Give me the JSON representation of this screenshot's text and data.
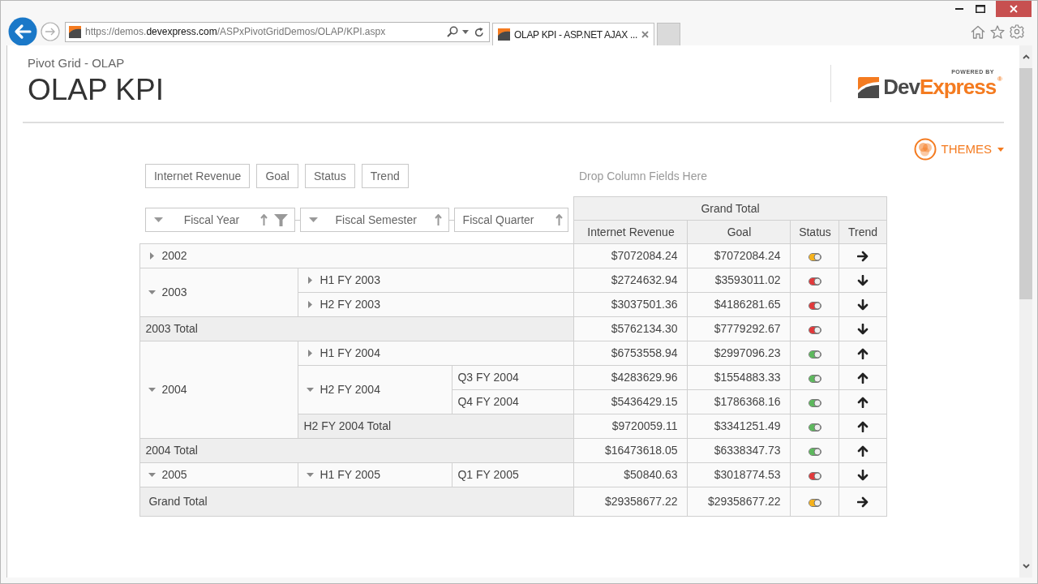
{
  "browser": {
    "address": {
      "url_before": "https://demos.",
      "url_domain": "devexpress.com",
      "url_after": "/ASPxPivotGridDemos/OLAP/KPI.aspx"
    },
    "tabs": [
      {
        "title": "OLAP KPI - ASP.NET AJAX ...",
        "selected": true
      }
    ]
  },
  "page": {
    "breadcrumb": "Pivot Grid - OLAP",
    "title": "OLAP KPI",
    "brand": {
      "tagline": "POWERED BY",
      "wordmark": "Dev",
      "wordmark_accent": "Express",
      "registered": "®"
    },
    "themes_button": "THEMES"
  },
  "pivot": {
    "data_fields": [
      "Internet Revenue",
      "Goal",
      "Status",
      "Trend"
    ],
    "column_area_hint": "Drop Column Fields Here",
    "row_fields": [
      {
        "label": "Fiscal Year",
        "expanded": true,
        "sort_ascending": true,
        "filtered": true
      },
      {
        "label": "Fiscal Semester",
        "expanded": true,
        "sort_ascending": true,
        "filtered": false
      },
      {
        "label": "Fiscal Quarter",
        "sort_ascending": true,
        "filtered": false
      }
    ],
    "column_header": "Grand Total",
    "measures": [
      "Internet Revenue",
      "Goal",
      "Status",
      "Trend"
    ],
    "rows": [
      {
        "label": "2002",
        "expanded": false,
        "values": {
          "internet_revenue": "$7072084.24",
          "goal": "$7072084.24",
          "status": {
            "color": "#f6b21a"
          },
          "trend": {
            "kind": "flat"
          }
        }
      },
      {
        "label": "2003",
        "expanded": true,
        "children": [
          {
            "label": "H1 FY 2003",
            "expanded": false,
            "values": {
              "internet_revenue": "$2724632.94",
              "goal": "$3593011.02",
              "status": {
                "color": "#e2383a"
              },
              "trend": {
                "kind": "down"
              }
            }
          },
          {
            "label": "H2 FY 2003",
            "expanded": false,
            "values": {
              "internet_revenue": "$3037501.36",
              "goal": "$4186281.65",
              "status": {
                "color": "#e2383a"
              },
              "trend": {
                "kind": "down"
              }
            }
          }
        ],
        "total": {
          "label": "2003 Total",
          "values": {
            "internet_revenue": "$5762134.30",
            "goal": "$7779292.67",
            "status": {
              "color": "#e2383a"
            },
            "trend": {
              "kind": "down"
            }
          }
        }
      },
      {
        "label": "2004",
        "expanded": true,
        "children": [
          {
            "label": "H1 FY 2004",
            "expanded": false,
            "values": {
              "internet_revenue": "$6753558.94",
              "goal": "$2997096.23",
              "status": {
                "color": "#5cb85c"
              },
              "trend": {
                "kind": "up"
              }
            }
          },
          {
            "label": "H2 FY 2004",
            "expanded": true,
            "children": [
              {
                "label": "Q3 FY 2004",
                "values": {
                  "internet_revenue": "$4283629.96",
                  "goal": "$1554883.33",
                  "status": {
                    "color": "#5cb85c"
                  },
                  "trend": {
                    "kind": "up"
                  }
                }
              },
              {
                "label": "Q4 FY 2004",
                "values": {
                  "internet_revenue": "$5436429.15",
                  "goal": "$1786368.16",
                  "status": {
                    "color": "#5cb85c"
                  },
                  "trend": {
                    "kind": "up"
                  }
                }
              }
            ],
            "total": {
              "label": "H2 FY 2004 Total",
              "values": {
                "internet_revenue": "$9720059.11",
                "goal": "$3341251.49",
                "status": {
                  "color": "#5cb85c"
                },
                "trend": {
                  "kind": "up"
                }
              }
            }
          }
        ],
        "total": {
          "label": "2004 Total",
          "values": {
            "internet_revenue": "$16473618.05",
            "goal": "$6338347.73",
            "status": {
              "color": "#5cb85c"
            },
            "trend": {
              "kind": "up"
            }
          }
        }
      },
      {
        "label": "2005",
        "expanded": true,
        "children": [
          {
            "label": "H1 FY 2005",
            "expanded": true,
            "children": [
              {
                "label": "Q1 FY 2005",
                "values": {
                  "internet_revenue": "$50840.63",
                  "goal": "$3018774.53",
                  "status": {
                    "color": "#e2383a"
                  },
                  "trend": {
                    "kind": "down"
                  }
                }
              }
            ]
          }
        ]
      }
    ],
    "grand_total": {
      "label": "Grand Total",
      "values": {
        "internet_revenue": "$29358677.22",
        "goal": "$29358677.22",
        "status": {
          "color": "#f6b21a"
        },
        "trend": {
          "kind": "flat"
        }
      }
    }
  }
}
